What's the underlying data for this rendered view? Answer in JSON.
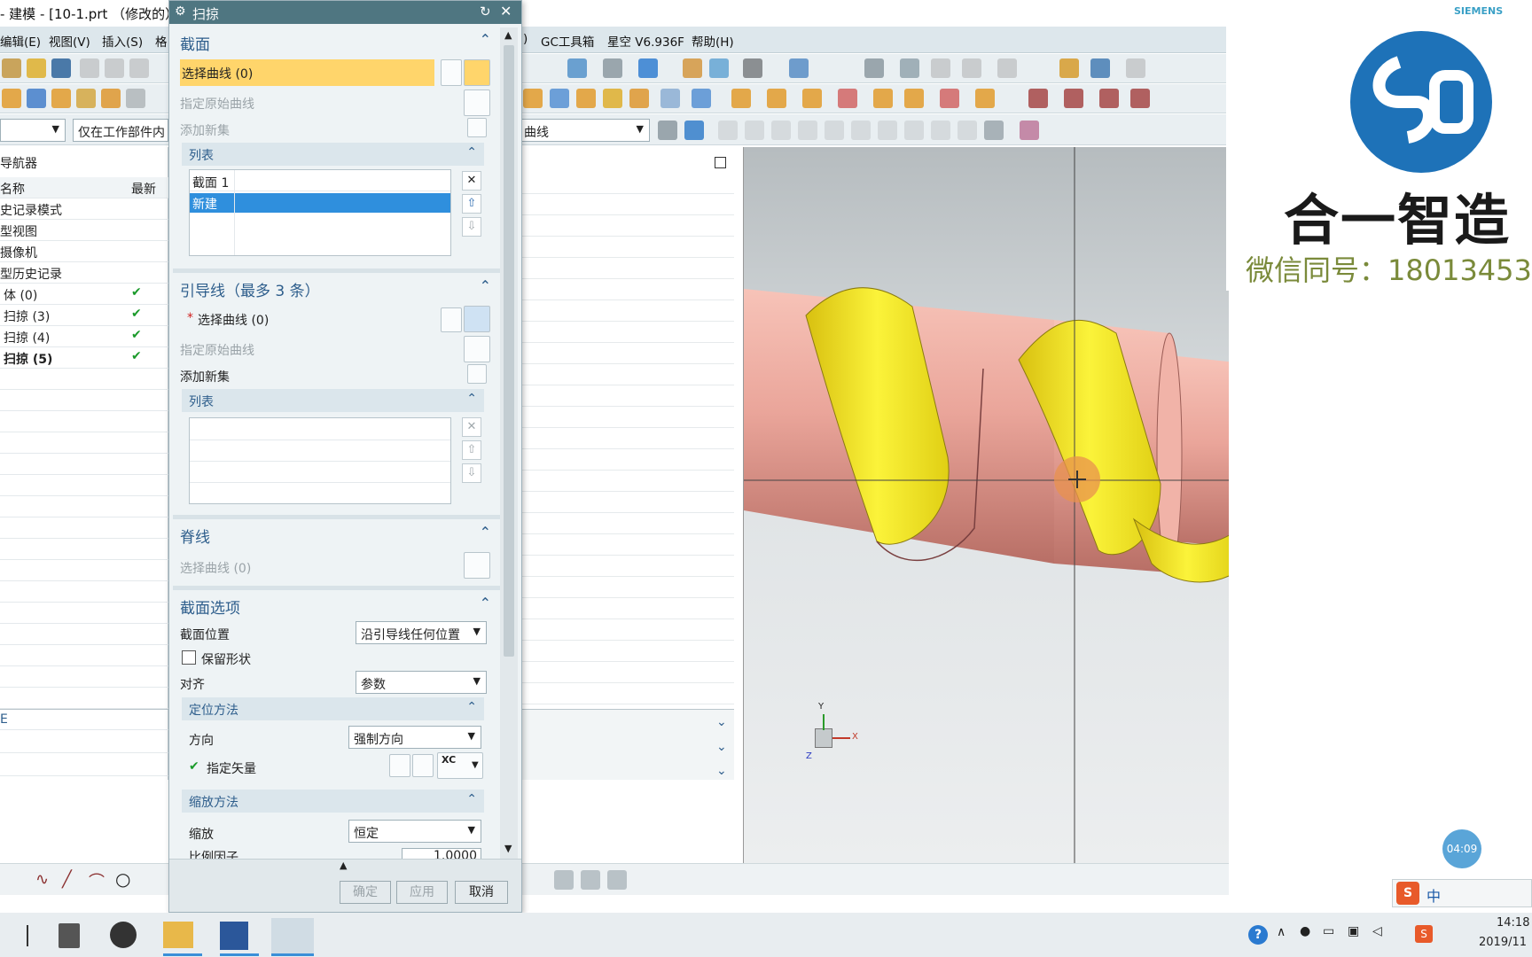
{
  "window": {
    "title": "- 建模 - [10-1.prt （修改的）"
  },
  "menubar": {
    "items": [
      "编辑(E)",
      "视图(V)",
      "插入(S)",
      "格"
    ],
    "right_items": [
      ")",
      "GC工具箱",
      "星空 V6.936F",
      "帮助(H)"
    ]
  },
  "filterbar": {
    "left_select": "",
    "scope_select": "仅在工作部件内",
    "curve_select": "曲线"
  },
  "navigator": {
    "title": "导航器",
    "col_name": "名称",
    "col_latest": "最新",
    "rows": [
      {
        "label": "史记录模式",
        "check": ""
      },
      {
        "label": "型视图",
        "check": ""
      },
      {
        "label": "摄像机",
        "check": ""
      },
      {
        "label": "型历史记录",
        "check": ""
      },
      {
        "label": "体 (0)",
        "check": "✔"
      },
      {
        "label": "扫掠 (3)",
        "check": "✔"
      },
      {
        "label": "扫掠 (4)",
        "check": "✔"
      },
      {
        "label": "扫掠 (5)",
        "check": "✔"
      }
    ],
    "bottom_label": "E"
  },
  "dialog": {
    "title": "扫掠",
    "section": {
      "title": "截面",
      "select_curve": "选择曲线 (0)",
      "specify_origin": "指定原始曲线",
      "add_new_set": "添加新集",
      "list_title": "列表",
      "list_rows": [
        "截面 1",
        "新建"
      ]
    },
    "guide": {
      "title": "引导线（最多 3 条）",
      "select_curve": "选择曲线 (0)",
      "required_mark": "*",
      "specify_origin": "指定原始曲线",
      "add_new_set": "添加新集",
      "list_title": "列表"
    },
    "spine": {
      "title": "脊线",
      "select_curve": "选择曲线 (0)"
    },
    "section_options": {
      "title": "截面选项",
      "position_label": "截面位置",
      "position_value": "沿引导线任何位置",
      "preserve_shape": "保留形状",
      "align_label": "对齐",
      "align_value": "参数",
      "orientation_title": "定位方法",
      "direction_label": "方向",
      "direction_value": "强制方向",
      "vector_label": "指定矢量",
      "vector_axis": "XC",
      "scaling_title": "缩放方法",
      "scale_label": "缩放",
      "scale_value": "恒定",
      "factor_label": "比例因子",
      "factor_value": "1.0000"
    },
    "buttons": {
      "ok": "确定",
      "apply": "应用",
      "cancel": "取消"
    }
  },
  "viewport": {
    "triad_x": "X",
    "triad_y": "Y",
    "triad_z": "Z"
  },
  "overlay": {
    "brand_text": "合一智造",
    "wechat_text": "微信同号：18013453",
    "corner_text": "SIEMENS",
    "timer": "04:09"
  },
  "taskbar": {
    "time": "14:18",
    "date": "2019/11",
    "ime_lang": "中"
  },
  "colors": {
    "part_pink": "#eaa59a",
    "sweep_yellow": "#f2ea20",
    "dialog_title_bg": "#4f7681",
    "highlight_row": "#ffd56b",
    "selected_row": "#2f8fdd"
  }
}
